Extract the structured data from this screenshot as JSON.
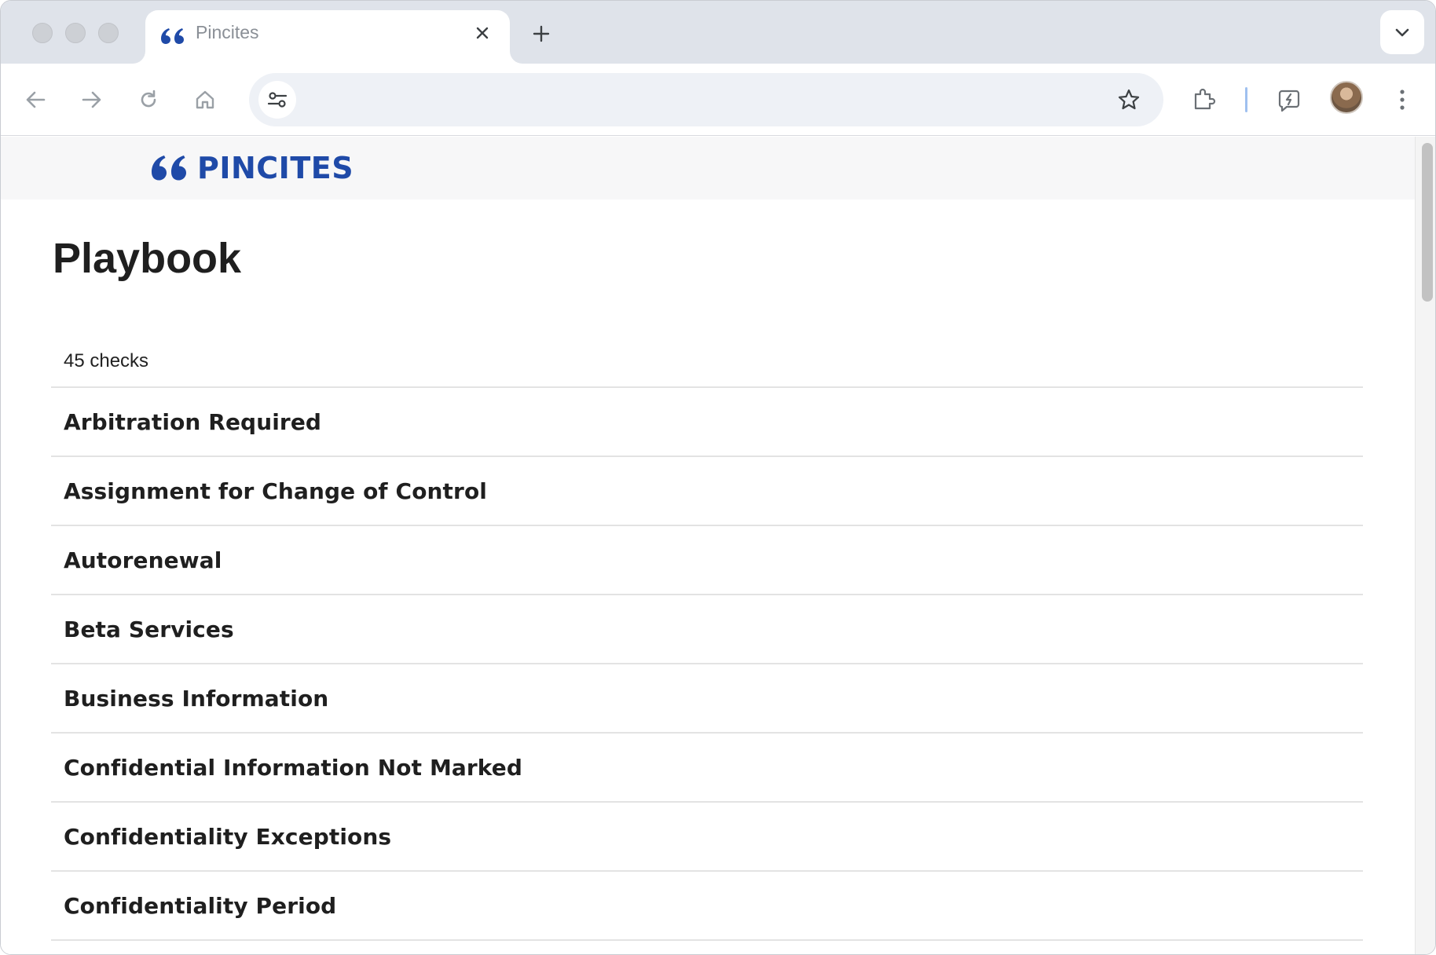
{
  "browser": {
    "tab": {
      "title": "Pincites"
    },
    "address_bar": {
      "value": "",
      "placeholder": ""
    },
    "icons": {
      "back": "arrow-left-icon",
      "forward": "arrow-right-icon",
      "reload": "reload-icon",
      "home": "home-icon",
      "site_settings": "tune-icon",
      "bookmark": "star-icon",
      "extensions": "puzzle-icon",
      "extension_app": "extension-app-icon",
      "menu": "kebab-menu-icon"
    }
  },
  "site": {
    "logo_text": "PINCITES",
    "brand_color": "#1f4aa8"
  },
  "page": {
    "title": "Playbook",
    "count_label": "45 checks",
    "checks": [
      "Arbitration Required",
      "Assignment for Change of Control",
      "Autorenewal",
      "Beta Services",
      "Business Information",
      "Confidential Information Not Marked",
      "Confidentiality Exceptions",
      "Confidentiality Period"
    ]
  }
}
